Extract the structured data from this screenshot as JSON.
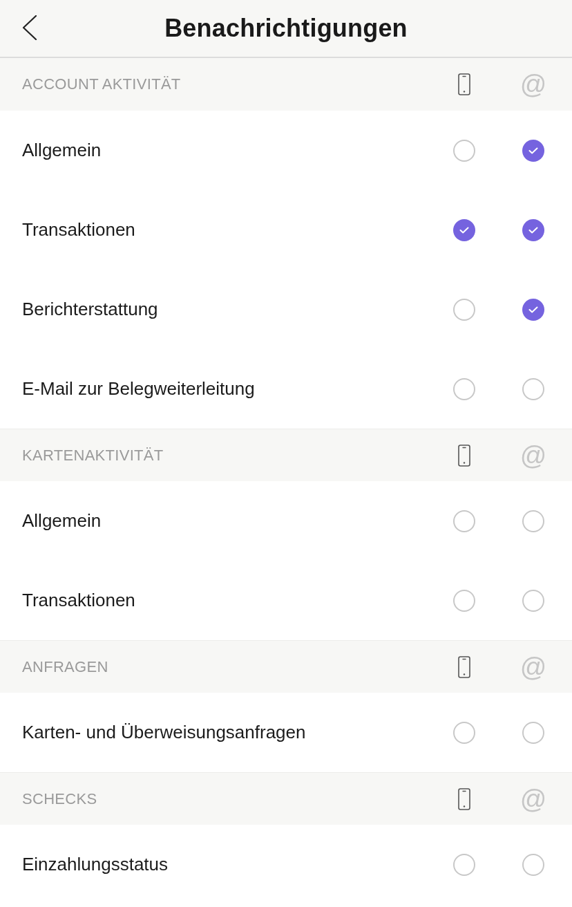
{
  "header": {
    "title": "Benachrichtigungen"
  },
  "sections": [
    {
      "title": "ACCOUNT AKTIVITÄT",
      "email_label": "@",
      "rows": [
        {
          "label": "Allgemein",
          "phone_checked": false,
          "email_checked": true
        },
        {
          "label": "Transaktionen",
          "phone_checked": true,
          "email_checked": true
        },
        {
          "label": "Berichterstattung",
          "phone_checked": false,
          "email_checked": true
        },
        {
          "label": "E-Mail zur Belegweiterleitung",
          "phone_checked": false,
          "email_checked": false
        }
      ]
    },
    {
      "title": "KARTENAKTIVITÄT",
      "email_label": "@",
      "rows": [
        {
          "label": "Allgemein",
          "phone_checked": false,
          "email_checked": false
        },
        {
          "label": "Transaktionen",
          "phone_checked": false,
          "email_checked": false
        }
      ]
    },
    {
      "title": "ANFRAGEN",
      "email_label": "@",
      "rows": [
        {
          "label": "Karten- und Überweisungsanfragen",
          "phone_checked": false,
          "email_checked": false
        }
      ]
    },
    {
      "title": "SCHECKS",
      "email_label": "@",
      "rows": [
        {
          "label": "Einzahlungsstatus",
          "phone_checked": false,
          "email_checked": false
        }
      ]
    }
  ]
}
